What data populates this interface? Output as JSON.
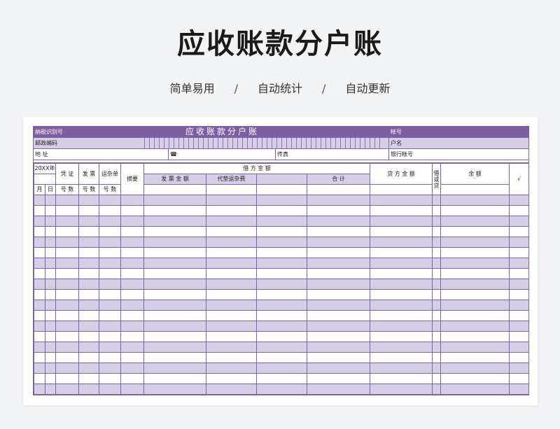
{
  "page": {
    "title": "应收账款分户账",
    "features": [
      "简单易用",
      "自动统计",
      "自动更新"
    ],
    "separator": "/"
  },
  "sheet": {
    "row1": {
      "tax_id_label": "纳税识别号",
      "title": "应收账款分户账",
      "account_label": "帐号"
    },
    "row2": {
      "postal_label": "邮政编码",
      "account_name_label": "户名"
    },
    "row3": {
      "address_label": "地 址",
      "phone_icon": "phone-icon",
      "phone_glyph": "☎",
      "fax_label": "传真",
      "bank_label": "银行帐号"
    },
    "header": {
      "year": "20XX年",
      "month": "月",
      "day": "日",
      "voucher_top": "凭 证",
      "voucher_bottom": "号 数",
      "invoice_top": "发 票",
      "invoice_bottom": "号 数",
      "waybill_top": "运杂单",
      "waybill_bottom": "号 数",
      "summary": "摘要",
      "debit_group": "借 方 金 额",
      "invoice_amount": "发 票 金 额",
      "freight_advance": "代垫运杂费",
      "total": "合 计",
      "credit_amount": "贷 方 金 额",
      "dc_label": "借或贷",
      "balance": "余 额",
      "check": "√"
    },
    "body_rows": 19
  },
  "colors": {
    "accent": "#7b5fa0",
    "stripe": "#d6cde6",
    "border": "#7b65a0"
  }
}
